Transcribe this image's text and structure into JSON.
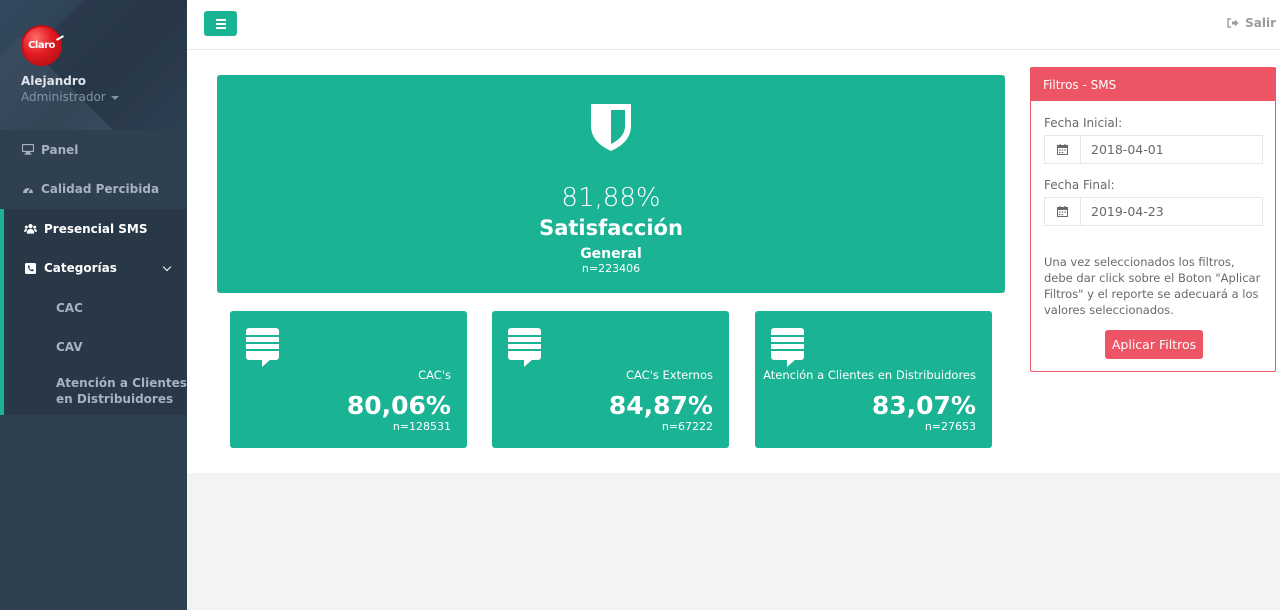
{
  "sidebar": {
    "logo_text": "Claro",
    "user_name": "Alejandro",
    "user_role": "Administrador",
    "nav": [
      {
        "label": "Panel",
        "icon": "monitor-icon"
      },
      {
        "label": "Calidad Percibida",
        "icon": "dashboard-gauge-icon"
      },
      {
        "label": "Presencial SMS",
        "icon": "users-icon"
      },
      {
        "label": "Categorías",
        "icon": "phone-square-icon"
      }
    ],
    "subnav": [
      "CAC",
      "CAV",
      "Atención a Clientes en Distribuidores"
    ]
  },
  "topbar": {
    "menu_icon": "hamburger-menu-icon",
    "logout_label": "Salir",
    "logout_icon": "sign-out-icon"
  },
  "hero": {
    "icon": "shield-icon",
    "value": "81,88%",
    "title": "Satisfacción",
    "subtitle": "General",
    "n": "n=223406"
  },
  "cards": [
    {
      "label": "CAC's",
      "value": "80,06%",
      "n": "n=128531",
      "icon": "chat-bubble-icon"
    },
    {
      "label": "CAC's Externos",
      "value": "84,87%",
      "n": "n=67222",
      "icon": "chat-bubble-icon"
    },
    {
      "label": "Atención a Clientes en Distribuidores",
      "value": "83,07%",
      "n": "n=27653",
      "icon": "chat-bubble-icon"
    }
  ],
  "filter": {
    "title": "Filtros - SMS",
    "start_label": "Fecha Inicial:",
    "start_value": "2018-04-01",
    "end_label": "Fecha Final:",
    "end_value": "2019-04-23",
    "help": "Una vez seleccionados los filtros, debe dar click sobre el Boton \"Aplicar Filtros\" y el reporte se adecuará a los valores seleccionados.",
    "apply_label": "Aplicar Filtros"
  },
  "colors": {
    "accent": "#1ab394",
    "danger": "#ed5565",
    "sidebar": "#2f4050"
  }
}
